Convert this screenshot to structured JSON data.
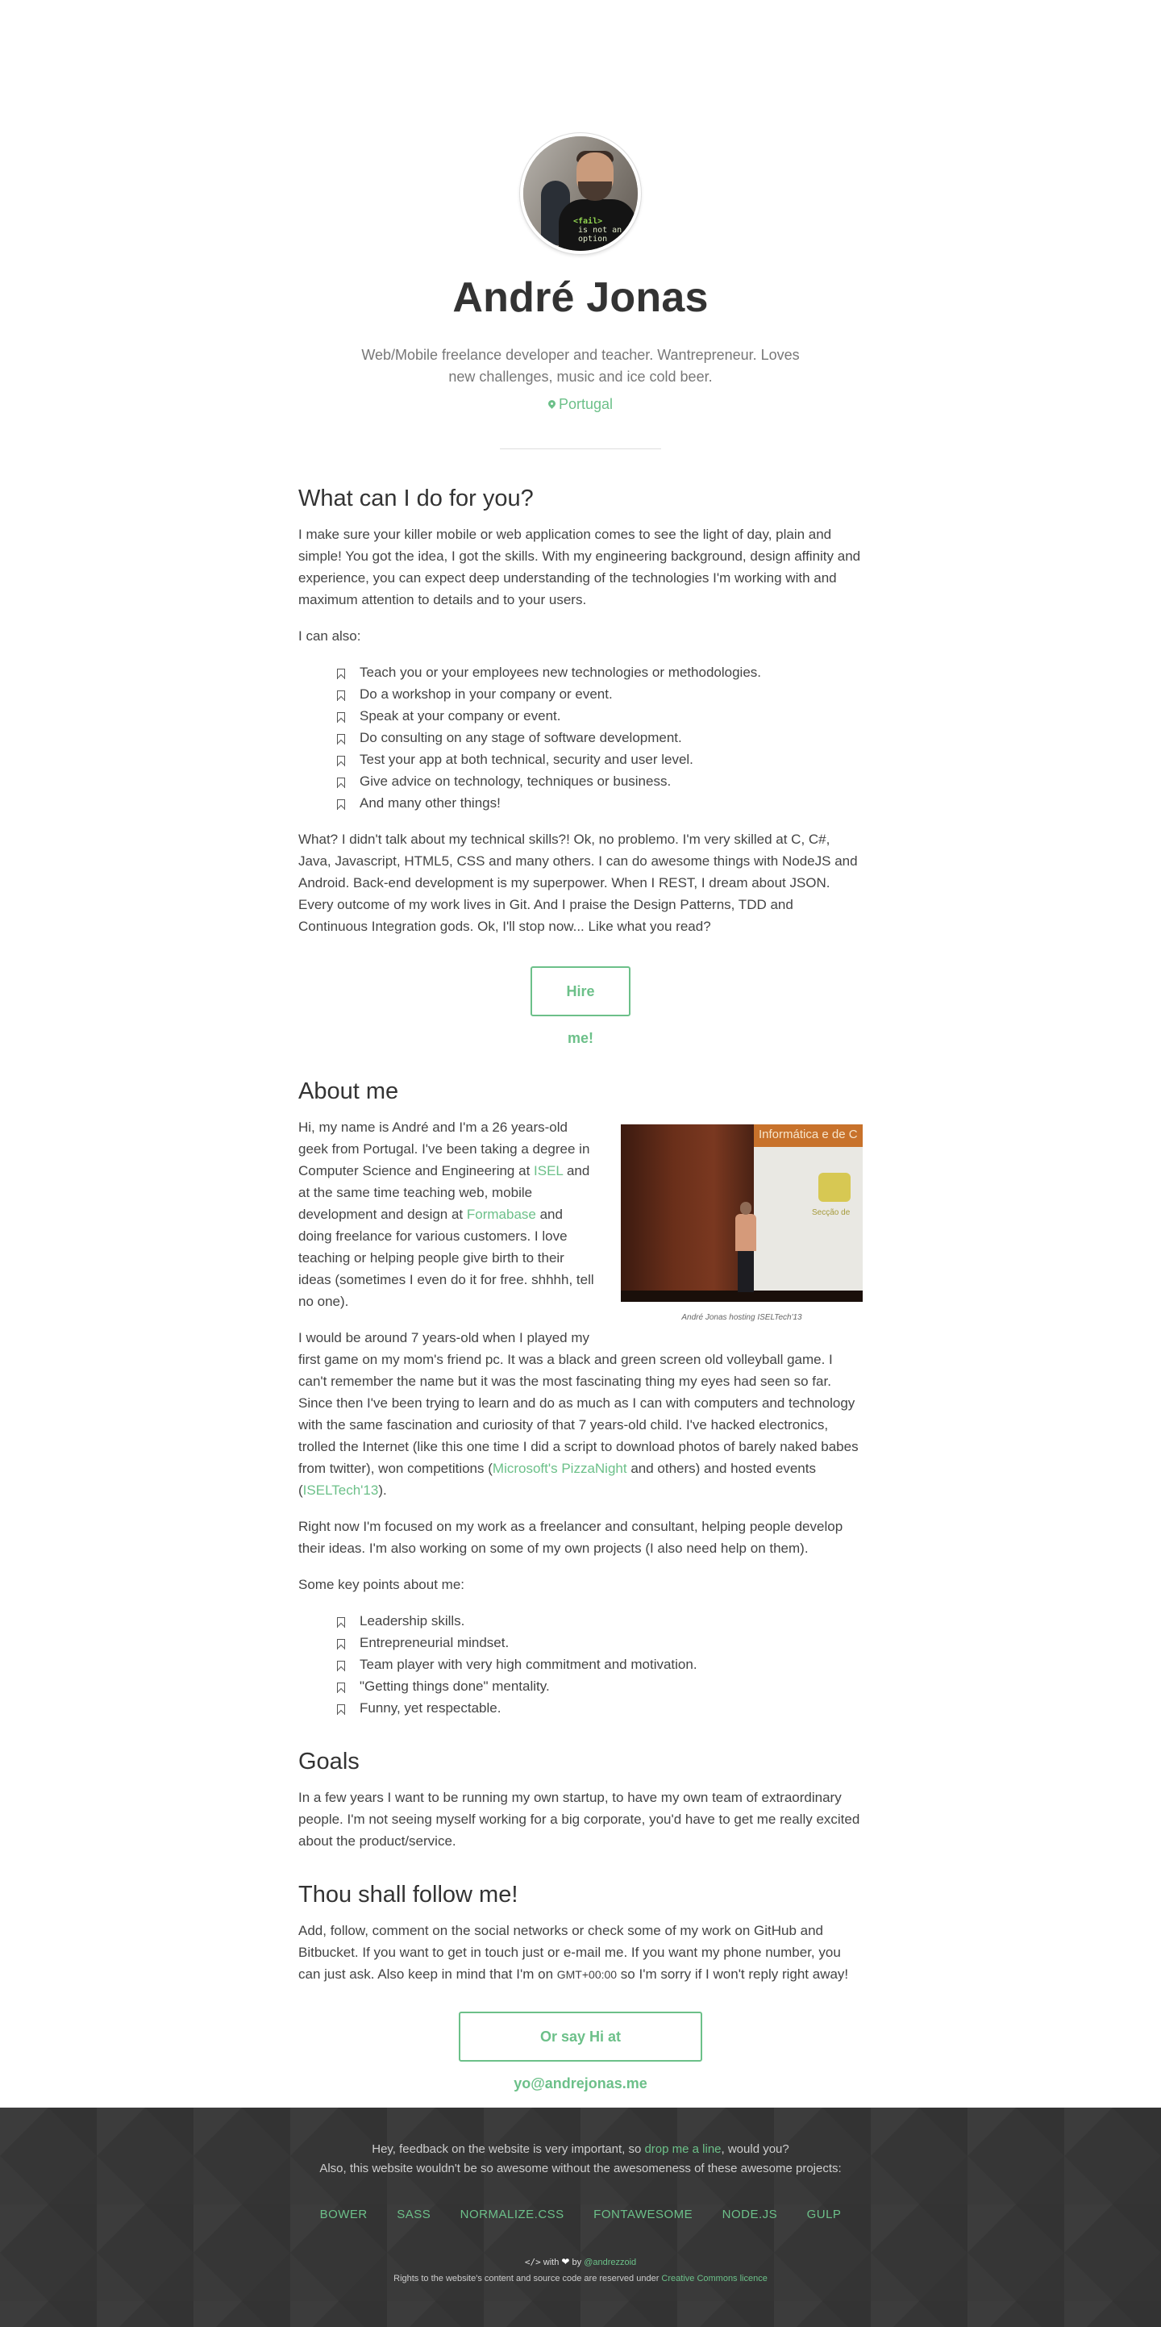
{
  "profile": {
    "name": "André Jonas",
    "bio": "Web/Mobile freelance developer and teacher. Wantrepreneur. Loves new challenges, music and ice cold beer.",
    "location": "Portugal"
  },
  "what_section": {
    "title": "What can I do for you?",
    "intro": "I make sure your killer mobile or web application comes to see the light of day, plain and simple! You got the idea, I got the skills. With my engineering background, design affinity and experience, you can expect deep understanding of the technologies I'm working with and maximum attention to details and to your users.",
    "also_label": "I can also:",
    "items": [
      "Teach you or your employees new technologies or methodologies.",
      "Do a workshop in your company or event.",
      "Speak at your company or event.",
      "Do consulting on any stage of software development.",
      "Test your app at both technical, security and user level.",
      "Give advice on technology, techniques or business.",
      "And many other things!"
    ],
    "skills": "What? I didn't talk about my technical skills?! Ok, no problemo. I'm very skilled at C, C#, Java, Javascript, HTML5, CSS and many others. I can do awesome things with NodeJS and Android. Back-end development is my superpower. When I REST, I dream about JSON. Every outcome of my work lives in Git. And I praise the Design Patterns, TDD and Continuous Integration gods. Ok, I'll stop now... Like what you read?",
    "hire_button": "Hire me!"
  },
  "about_section": {
    "title": "About me",
    "p1_a": "Hi, my name is André and I'm a 26 years-old geek from Portugal. I've been taking a degree in Computer Science and Engineering at ",
    "p1_link1": "ISEL",
    "p1_b": " and at the same time teaching web, mobile development and design at ",
    "p1_link2": "Formabase",
    "p1_c": " and doing freelance for various customers. I love teaching or helping people give birth to their ideas (sometimes I even do it for free. shhhh, tell no one).",
    "photo_caption": "André Jonas hosting ISELTech'13",
    "photo_screen_text": "Informática e de C",
    "photo_logo_text": "Secção de",
    "p2_a": "I would be around 7 years-old when I played my first game on my mom's friend pc. It was a black and green screen old volleyball game. I can't remember the name but it was the most fascinating thing my eyes had seen so far. Since then I've been trying to learn and do as much as I can with computers and technology with the same fascination and curiosity of that 7 years-old child. I've hacked electronics, trolled the Internet (like this one time I did a script to download photos of barely naked babes from twitter), won competitions (",
    "p2_link1": "Microsoft's PizzaNight",
    "p2_b": " and others) and hosted events (",
    "p2_link2": "ISELTech'13",
    "p2_c": ").",
    "p3": "Right now I'm focused on my work as a freelancer and consultant, helping people develop their ideas. I'm also working on some of my own projects (I also need help on them).",
    "key_label": "Some key points about me:",
    "key_points": [
      "Leadership skills.",
      "Entrepreneurial mindset.",
      "Team player with very high commitment and motivation.",
      "\"Getting things done\" mentality.",
      "Funny, yet respectable."
    ]
  },
  "goals_section": {
    "title": "Goals",
    "text": "In a few years I want to be running my own startup, to have my own team of extraordinary people. I'm not seeing myself working for a big corporate, you'd have to get me really excited about the product/service."
  },
  "follow_section": {
    "title": "Thou shall follow me!",
    "text_a": "Add, follow, comment on the social networks or check some of my work on GitHub and Bitbucket. If you want to get in touch just or e-mail me. If you want my phone number, you can just ask. Also keep in mind that I'm on ",
    "timezone": "GMT+00:00",
    "text_b": " so I'm sorry if I won't reply right away!",
    "cta_button": "Or say Hi at yo@andrejonas.me"
  },
  "footer": {
    "feedback_a": "Hey, feedback on the website is very important, so ",
    "feedback_link": "drop me a line",
    "feedback_b": ", would you?",
    "thanks": "Also, this website wouldn't be so awesome without the awesomeness of these awesome projects:",
    "projects": [
      "BOWER",
      "SASS",
      "NORMALIZE.CSS",
      "FONTAWESOME",
      "NODE.JS",
      "GULP"
    ],
    "made_code": "</>",
    "made_with": " with ",
    "made_by": " by ",
    "handle": "@andrezzoid",
    "rights_a": "Rights to the website's content and source code are reserved under ",
    "rights_link": "Creative Commons licence"
  },
  "colors": {
    "accent": "#6cc089",
    "text": "#333333",
    "footer_bg": "#363636"
  },
  "icons": {
    "location": "map-marker-icon",
    "list_bullet": "bookmark-icon",
    "heart": "heart-icon",
    "code": "code-icon"
  }
}
